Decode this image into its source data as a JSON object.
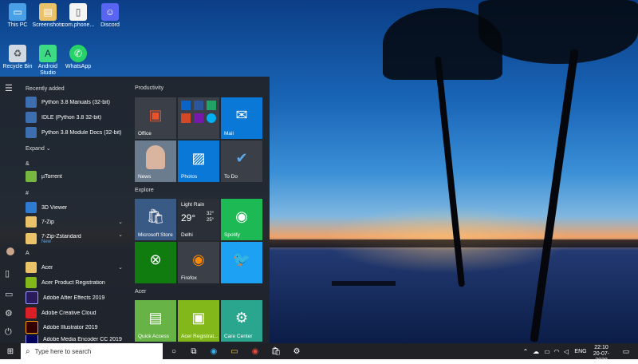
{
  "desktop": {
    "icons": [
      {
        "label": "This PC",
        "icon": "this-pc-icon"
      },
      {
        "label": "Screenshots",
        "icon": "folder-icon"
      },
      {
        "label": "com.phone...",
        "icon": "file-icon"
      },
      {
        "label": "Discord",
        "icon": "discord-icon"
      },
      {
        "label": "Recycle Bin",
        "icon": "recycle-bin-icon"
      },
      {
        "label": "Android Studio",
        "icon": "android-studio-icon"
      },
      {
        "label": "WhatsApp",
        "icon": "whatsapp-icon"
      }
    ]
  },
  "start_menu": {
    "recently_added_label": "Recently added",
    "recent": [
      {
        "label": "Python 3.8 Manuals (32-bit)"
      },
      {
        "label": "IDLE (Python 3.8 32-bit)"
      },
      {
        "label": "Python 3.8 Module Docs (32-bit)"
      }
    ],
    "expand_label": "Expand",
    "section_amp": "&",
    "utorrent": "µTorrent",
    "section_hash": "#",
    "viewer": "3D Viewer",
    "zip": "7-Zip",
    "zip_z": "7-Zip-Zstandard",
    "new_badge": "New",
    "section_a": "A",
    "acer": "Acer",
    "acer_reg": "Acer Product Registration",
    "after_effects": "Adobe After Effects 2019",
    "creative_cloud": "Adobe Creative Cloud",
    "illustrator": "Adobe Illustrator 2019",
    "media_encoder": "Adobe Media Encoder CC 2019",
    "productivity_title": "Productivity",
    "explore_title": "Explore",
    "acer_title": "Acer",
    "tiles": {
      "office": "Office",
      "mail": "Mail",
      "news": "News",
      "photos": "Photos",
      "todo": "To Do",
      "store": "Microsoft Store",
      "weather_cond": "Light Rain",
      "weather_temp": "29°",
      "weather_high": "32°",
      "weather_low": "25°",
      "weather_city": "Delhi",
      "spotify": "Spotify",
      "firefox": "Firefox",
      "quick_access": "Quick Access",
      "acer_registration": "Acer Registrat...",
      "care_center": "Care Center"
    }
  },
  "taskbar": {
    "search_placeholder": "Type here to search",
    "lang": "ENG",
    "time": "22:10",
    "date": "20-07-2020"
  }
}
